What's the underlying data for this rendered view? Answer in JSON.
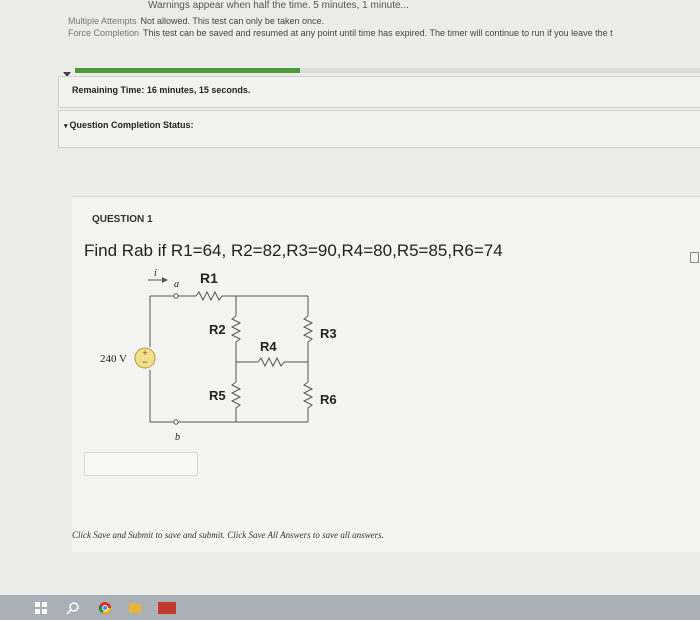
{
  "header": {
    "warning_line": "Warnings appear when half the time. 5 minutes, 1 minute..."
  },
  "info": {
    "attempts_key": "Multiple Attempts",
    "attempts_val": "Not allowed. This test can only be taken once.",
    "force_key": "Force Completion",
    "force_val": "This test can be saved and resumed at any point until time has expired. The timer will continue to run if you leave the t"
  },
  "timer": {
    "label": "Remaining Time: 16 minutes, 15 seconds.",
    "progress_fraction": 0.36
  },
  "completion": {
    "label": "Question Completion Status:"
  },
  "question": {
    "number": "QUESTION 1",
    "text": "Find Rab if R1=64, R2=82,R3=90,R4=80,R5=85,R6=74",
    "circuit": {
      "current": "i",
      "node_a": "a",
      "node_b": "b",
      "source": "240 V",
      "r1": "R1",
      "r2": "R2",
      "r3": "R3",
      "r4": "R4",
      "r5": "R5",
      "r6": "R6"
    }
  },
  "footer": {
    "note": "Click Save and Submit to save and submit. Click Save All Answers to save all answers."
  }
}
